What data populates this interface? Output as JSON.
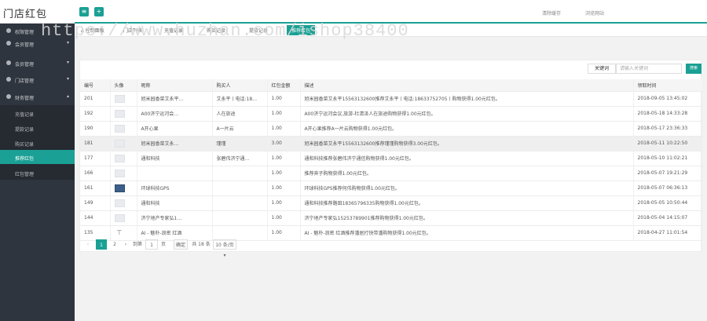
{
  "app": {
    "brand": "门店红包"
  },
  "topbar": {
    "menu_icon": "≡",
    "add_icon": "+",
    "clear_cache": "清除缓存",
    "view_site": "浏览网站"
  },
  "watermark": "https://www.huzhan.com/ishop38400",
  "sidebar": {
    "items": [
      {
        "label": "权限管理",
        "icon": "gear-icon"
      },
      {
        "label": "会员管理",
        "icon": "users-icon"
      },
      {
        "label": "会员管理",
        "icon": "users-icon"
      },
      {
        "label": "门店管理",
        "icon": "store-icon"
      },
      {
        "label": "财务管理",
        "icon": "finance-icon"
      }
    ],
    "sub_items": [
      {
        "label": "充值记录"
      },
      {
        "label": "提款记录"
      },
      {
        "label": "购买记录"
      },
      {
        "label": "推荐红包"
      },
      {
        "label": "红包管理"
      }
    ]
  },
  "tabs": [
    {
      "label": "控制面板",
      "icon": "home-icon"
    },
    {
      "label": "门店列表"
    },
    {
      "label": "充值记录"
    },
    {
      "label": "购买记录"
    },
    {
      "label": "提款记录"
    },
    {
      "label": "推荐红包"
    }
  ],
  "search": {
    "keyword_button": "关键词",
    "placeholder": "请输入关键词",
    "go_button": "搜索"
  },
  "table": {
    "columns": [
      "编号",
      "头像",
      "昵称",
      "购买人",
      "红包金额",
      "描述",
      "领取时间"
    ],
    "rows": [
      {
        "id": "201",
        "nickname": "旭米园香菜艾永平…",
        "buyer": "艾永平丨电话:18…",
        "amount": "1.00",
        "desc": "旭米园香菜艾永平15563132600推荐艾永平丨电话:18633752705丨购物获得1.00元红包。",
        "time": "2018-09-05 13:45:02"
      },
      {
        "id": "192",
        "nickname": "A00济宁运河会…",
        "buyer": "人在旅途",
        "amount": "1.00",
        "desc": "A00济宁运河会议,旅游-杜清泽人在旅途购物获得1.00元红包。",
        "time": "2018-05-18 14:33:28"
      },
      {
        "id": "190",
        "nickname": "A开心果",
        "buyer": "A一片云",
        "amount": "1.00",
        "desc": "A开心果推荐A一片云购物获得1.00元红包。",
        "time": "2018-05-17 23:36:33"
      },
      {
        "id": "181",
        "nickname": "旭米园香菜艾永…",
        "buyer": "瑾瑾",
        "amount": "3.00",
        "desc": "旭米园香菜艾永平15563132600推荐瑾瑾购物获得3.00元红包。",
        "time": "2018-05-11 10:22:50"
      },
      {
        "id": "177",
        "nickname": "通和科技",
        "buyer": "张碧伟济宁通…",
        "amount": "1.00",
        "desc": "通和科技推荐张碧伟济宁通信购物获得1.00元红包。",
        "time": "2018-05-10 11:02:21"
      },
      {
        "id": "166",
        "nickname": "",
        "buyer": "",
        "amount": "1.00",
        "desc": "推荐奔子购物获得1.00元红包。",
        "time": "2018-05-07 19:21:29"
      },
      {
        "id": "161",
        "nickname": "环球科技GPS",
        "buyer": "",
        "amount": "1.00",
        "desc": "环球科技GPS推荐何伟购物获得1.00元红包。",
        "time": "2018-05-07 06:36:13"
      },
      {
        "id": "149",
        "nickname": "通和科技",
        "buyer": "",
        "amount": "1.00",
        "desc": "通和科技推荐路田18365796335购物获得1.00元红包。",
        "time": "2018-05-05 10:50:44"
      },
      {
        "id": "144",
        "nickname": "济宁地产专家弘1…",
        "buyer": "",
        "amount": "1.00",
        "desc": "济宁地产专家弘15253789901推荐购物获得1.00元红包。",
        "time": "2018-05-04 14:15:07"
      },
      {
        "id": "135",
        "nickname": "AI - 魅朴-浪密 红酒",
        "buyer": "",
        "amount": "1.00",
        "desc": "AI - 魅朴-浪密 红酒推荐潘居打快带潘购物获得1.00元红包。",
        "time": "2018-04-27 11:01:54"
      }
    ]
  },
  "pager": {
    "prev": "‹",
    "page1": "1",
    "page2": "2",
    "next": "›",
    "goto_label": "到第",
    "goto_value": "1",
    "page_unit": "页",
    "confirm": "确定",
    "total": "共 18 条",
    "per_page": "10 条/页 ▾"
  }
}
